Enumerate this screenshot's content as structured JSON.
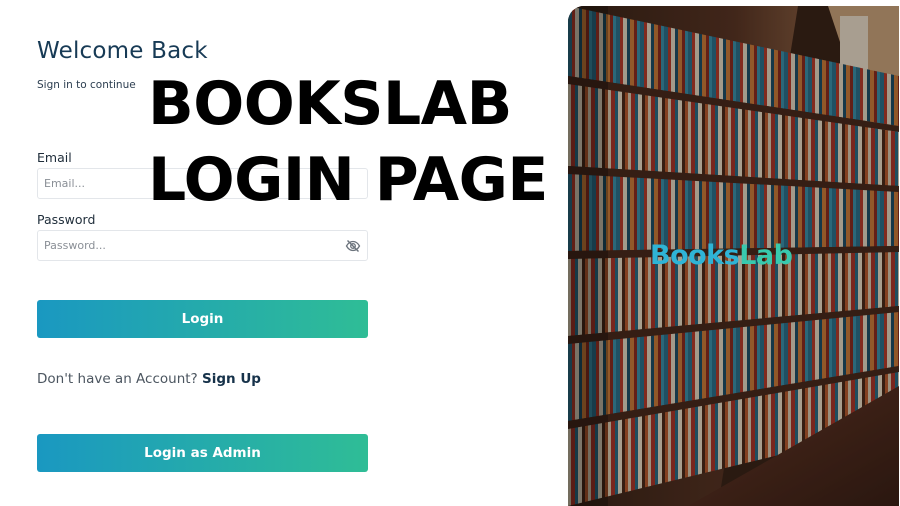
{
  "form": {
    "title": "Welcome Back",
    "subtitle": "Sign in to continue",
    "email": {
      "label": "Email",
      "placeholder": "Email..."
    },
    "password": {
      "label": "Password",
      "placeholder": "Password...",
      "toggle_icon": "eye-slash-icon"
    },
    "login_button": "Login",
    "signup_prompt": "Don't have an Account?",
    "signup_link": "Sign Up",
    "admin_button": "Login as Admin"
  },
  "overlay": {
    "line1": "BOOKSLAB",
    "line2": "LOGIN PAGE"
  },
  "brand": {
    "part1": "Books",
    "part2": "Lab"
  },
  "colors": {
    "button_gradient_start": "#1a98c1",
    "button_gradient_end": "#2fbd96",
    "title": "#173a55",
    "brand_blue": "#2fb4d6",
    "brand_teal": "#38c9ad"
  }
}
